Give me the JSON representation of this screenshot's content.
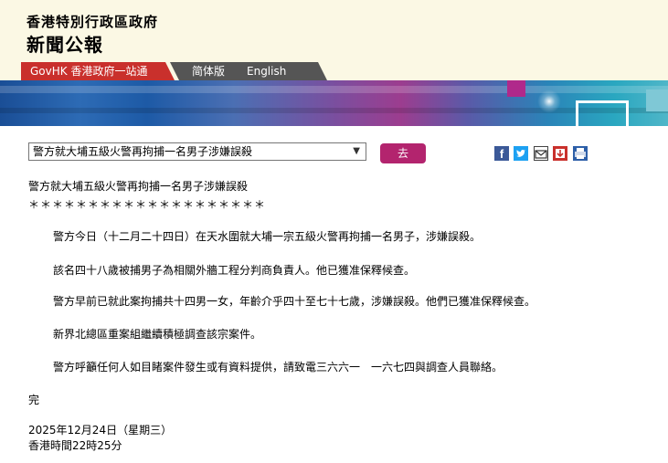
{
  "header": {
    "org_name": "香港特別行政區政府",
    "site_name": "新聞公報"
  },
  "nav": {
    "govhk_label": "GovHK 香港政府一站通",
    "simplified_label": "简体版",
    "english_label": "English"
  },
  "toolbar": {
    "selected_article": "警方就大埔五級火警再拘捕一名男子涉嫌誤殺",
    "go_label": "去",
    "share_icons": [
      "facebook-icon",
      "twitter-icon",
      "email-icon",
      "download-icon",
      "print-icon"
    ]
  },
  "article": {
    "title": "警方就大埔五級火警再拘捕一名男子涉嫌誤殺",
    "separator": "＊＊＊＊＊＊＊＊＊＊＊＊＊＊＊＊＊＊＊＊",
    "paragraphs": [
      "警方今日（十二月二十四日）在天水圍就大埔一宗五級火警再拘捕一名男子，涉嫌誤殺。",
      "該名四十八歲被捕男子為相關外牆工程分判商負責人。他已獲准保釋候查。",
      "警方早前已就此案拘捕共十四男一女，年齡介乎四十至七十七歲，涉嫌誤殺。他們已獲准保釋候查。",
      "新界北總區重案組繼續積極調查該宗案件。",
      "警方呼籲任何人如目睹案件發生或有資料提供，請致電三六六一　一六七四與調查人員聯絡。"
    ],
    "end_mark": "完",
    "date": "2025年12月24日（星期三）",
    "time": "香港時間22時25分"
  },
  "colors": {
    "header_bg": "#fbf8e4",
    "govhk_tab": "#c9302c",
    "lang_tab": "#555555",
    "go_button": "#b3246e"
  }
}
